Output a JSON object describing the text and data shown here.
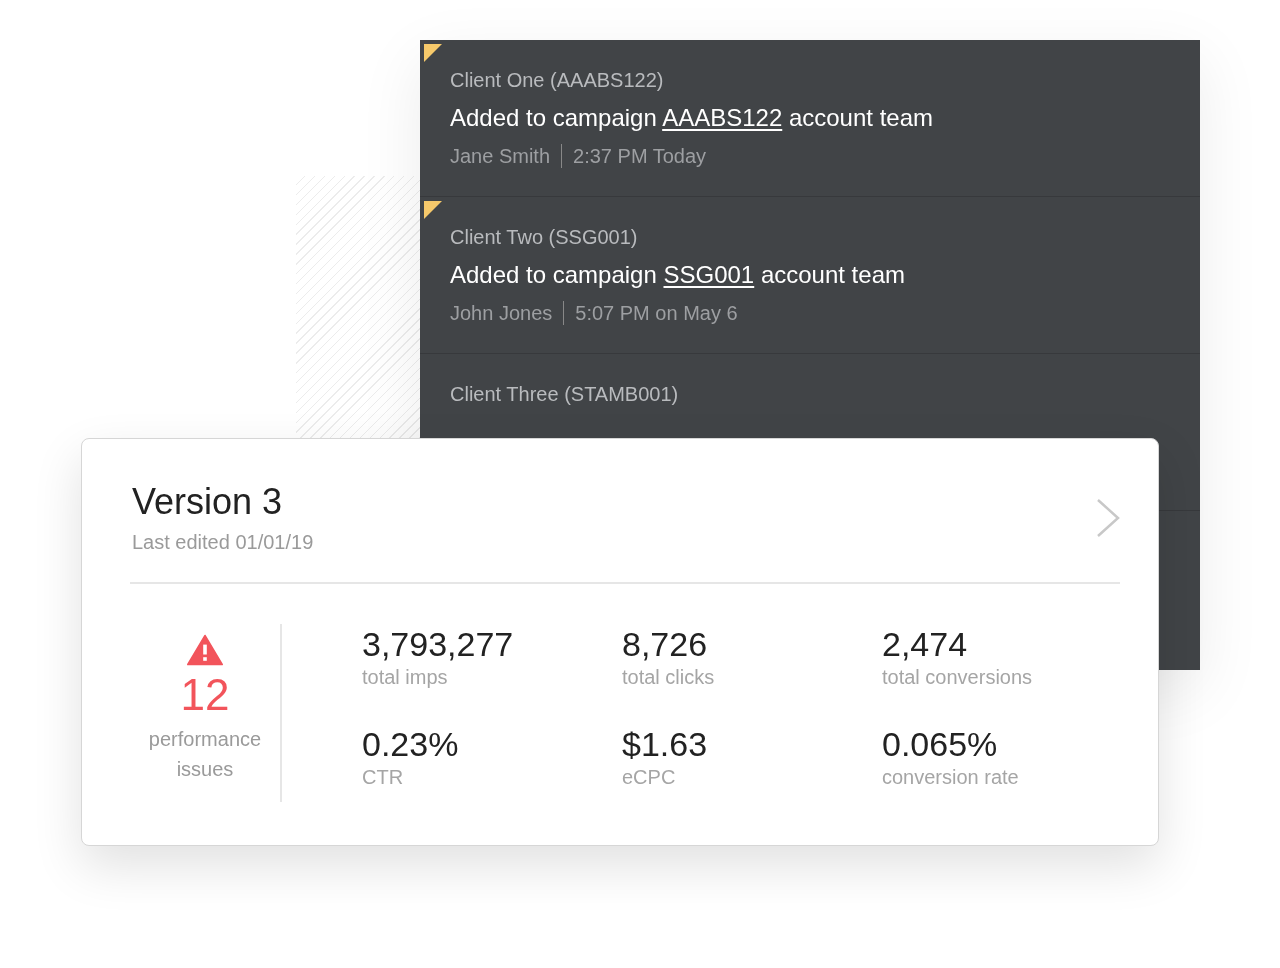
{
  "activity_feed": {
    "items": [
      {
        "unread": true,
        "client": "Client One (AAABS122)",
        "message_prefix": "Added to campaign",
        "campaign_code": "AAABS122",
        "message_suffix": "account team",
        "author": "Jane Smith",
        "time": "2:37 PM Today"
      },
      {
        "unread": true,
        "client": "Client Two (SSG001)",
        "message_prefix": "Added to campaign",
        "campaign_code": "SSG001",
        "message_suffix": "account team",
        "author": "John Jones",
        "time": "5:07 PM on May 6"
      },
      {
        "unread": false,
        "client": "Client Three (STAMB001)"
      }
    ]
  },
  "version_card": {
    "title": "Version 3",
    "subtitle": "Last edited 01/01/19",
    "issues": {
      "count": "12",
      "label": "performance issues"
    },
    "metrics": [
      {
        "value": "3,793,277",
        "label": "total imps"
      },
      {
        "value": "8,726",
        "label": "total clicks"
      },
      {
        "value": "2,474",
        "label": "total conversions"
      },
      {
        "value": "0.23%",
        "label": "CTR"
      },
      {
        "value": "$1.63",
        "label": "eCPC"
      },
      {
        "value": "0.065%",
        "label": "conversion rate"
      }
    ]
  }
}
